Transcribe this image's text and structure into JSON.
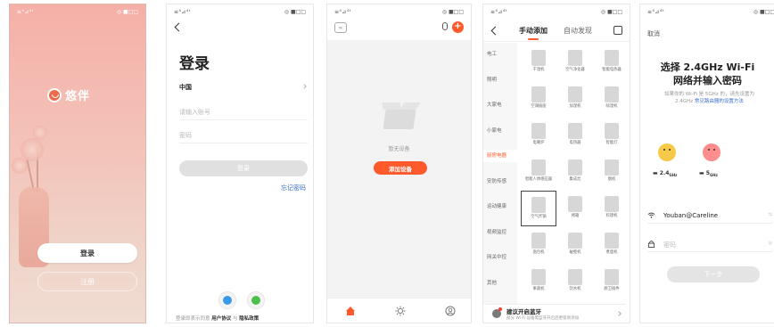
{
  "statusbar": {
    "signal": "≡⁴⊿⁴ᵗ",
    "battery": "◎ ■□□"
  },
  "splash": {
    "app_name": "悠伴",
    "login_label": "登录",
    "register_label": "注册"
  },
  "login": {
    "title": "登录",
    "country": "中国",
    "phone_placeholder": "请输入账号",
    "password_placeholder": "密码",
    "login_button": "登录",
    "forgot_password": "忘记密码",
    "agreement_prefix": "登录即表示同意",
    "agreement_user": "用户协议",
    "agreement_and": "与",
    "agreement_privacy": "隐私政策"
  },
  "home": {
    "empty_text": "暂无设备",
    "add_device": "添加设备"
  },
  "add_device": {
    "tab_manual": "手动添加",
    "tab_auto": "自动发现",
    "categories": [
      "电工",
      "照明",
      "大家电",
      "小家电",
      "厨房电器",
      "安防传感",
      "运动健康",
      "视频监控",
      "网关中控",
      "其他"
    ],
    "active_category_index": 4,
    "devices": [
      [
        "干湿机",
        "空气净化器",
        "智能电热器"
      ],
      [
        "空调插座",
        "加湿机",
        "除湿机"
      ],
      [
        "电暖炉",
        "电热器",
        "智能灯"
      ],
      [
        "智能人体感应器",
        "集成灶",
        "烟机"
      ],
      [
        "空气炸锅",
        "烤箱",
        "料理机"
      ],
      [
        "面包机",
        "破壁机",
        "煮蛋机"
      ],
      [
        "果蔬机",
        "饮水机",
        "厨卫插件"
      ]
    ],
    "selected_device": "空气炸锅",
    "bluetooth_title": "建议开启蓝牙",
    "bluetooth_sub": "部分 Wi-Fi 设备需蓝牙开启后更容易添加"
  },
  "wifi": {
    "cancel": "取消",
    "title_line1": "选择 2.4GHz Wi-Fi",
    "title_line2": "网络并输入密码",
    "desc": "如果你的 Wi-Fi 是 5GHz 的，请先设置为 2.4GHz",
    "desc_link": "常见路由器的设置方法",
    "freq_24": "2.4",
    "freq_24_unit": "GHz",
    "freq_5": "5",
    "freq_5_unit": "GHz",
    "ssid": "Youban@Careline",
    "ssid_action": "⇆",
    "password_placeholder": "密码",
    "next": "下一步"
  },
  "colors": {
    "accent": "#ff5a2b",
    "link": "#3a6fcf"
  }
}
